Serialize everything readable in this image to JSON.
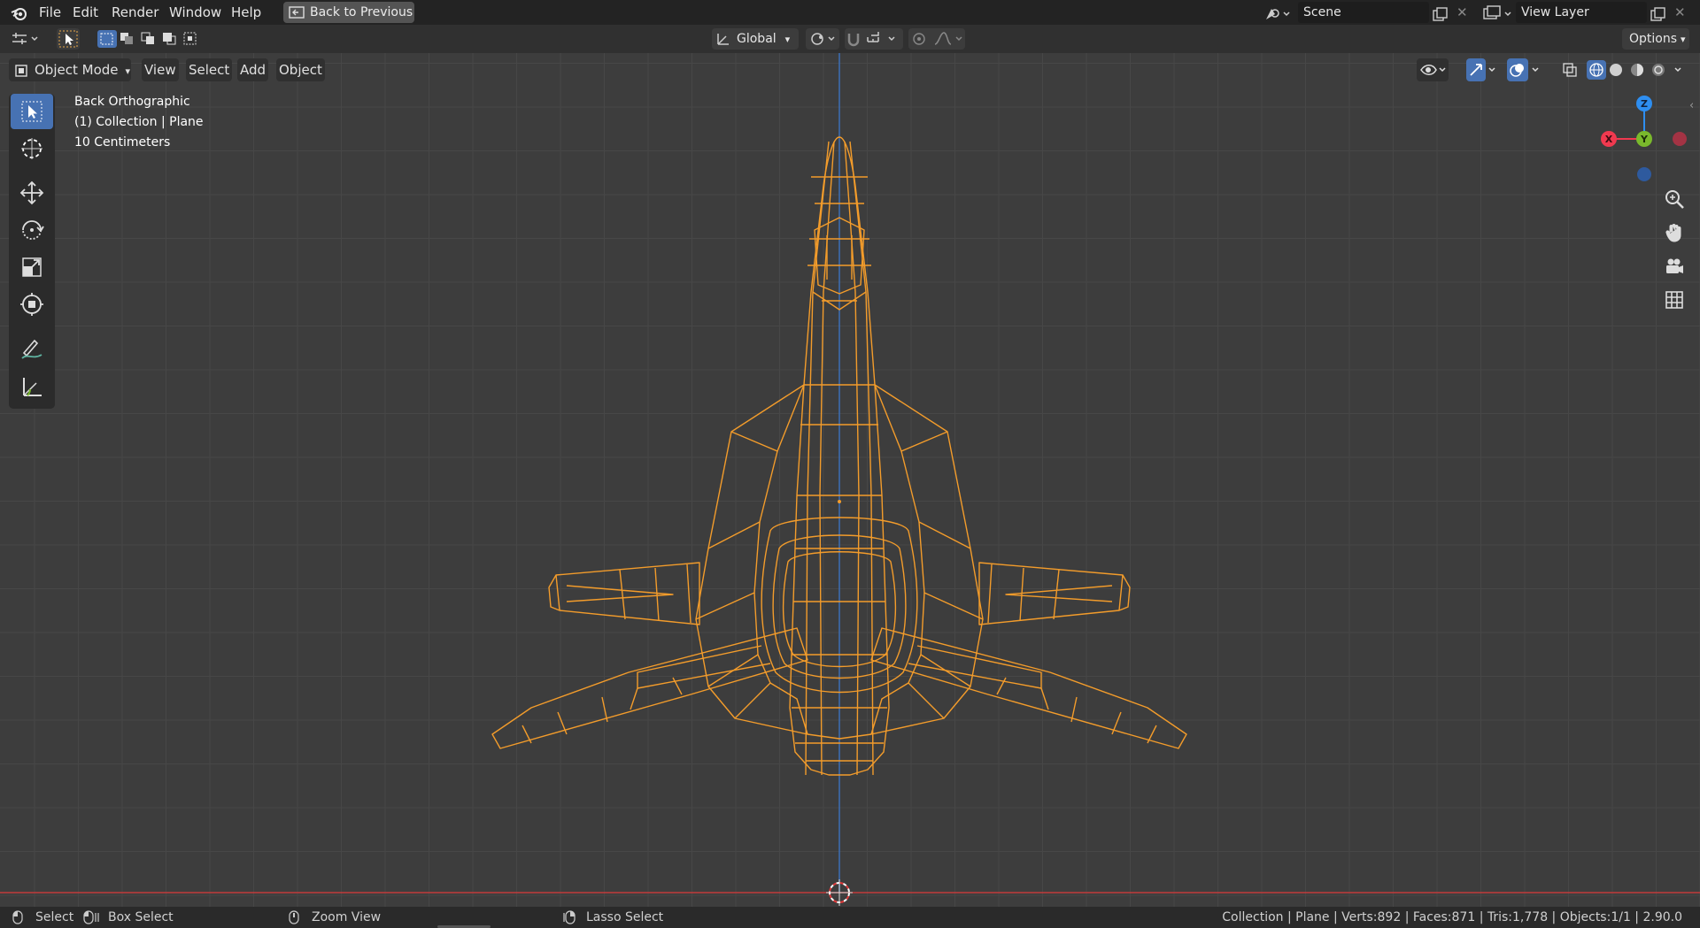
{
  "menu": {
    "file": "File",
    "edit": "Edit",
    "render": "Render",
    "window": "Window",
    "help": "Help",
    "back_to_previous": "Back to Previous"
  },
  "scene": {
    "name": "Scene"
  },
  "view_layer": {
    "name": "View Layer"
  },
  "header_tools": {
    "orientation": "Global",
    "options": "Options"
  },
  "viewport_header": {
    "mode": "Object Mode",
    "view": "View",
    "select": "Select",
    "add": "Add",
    "object": "Object"
  },
  "overlay": {
    "view_name": "Back Orthographic",
    "collection": "(1) Collection | Plane",
    "scale": "10 Centimeters"
  },
  "gizmo": {
    "x": "X",
    "y": "Y",
    "z": "Z"
  },
  "status": {
    "select": "Select",
    "box_select": "Box Select",
    "zoom_view": "Zoom View",
    "lasso_select": "Lasso Select",
    "stats": "Collection | Plane | Verts:892 | Faces:871 | Tris:1,778 | Objects:1/1 | 2.90.0"
  },
  "colors": {
    "accent_blue": "#4772b3",
    "wire_orange": "#f39c2b",
    "axis_red": "#c23b3b",
    "axis_blue": "#3d6fb5",
    "gizmo_x": "#f0394f",
    "gizmo_y": "#7ab92c",
    "gizmo_z": "#2e8ef0"
  },
  "icons": [
    "blender-logo-icon",
    "editor-type-icon",
    "select-box-icon",
    "move-icon",
    "rotate-icon",
    "scale-icon",
    "transform-icon",
    "annotate-icon",
    "measure-icon",
    "cursor-icon",
    "zoom-icon",
    "hand-icon",
    "camera-icon",
    "grid-icon"
  ]
}
